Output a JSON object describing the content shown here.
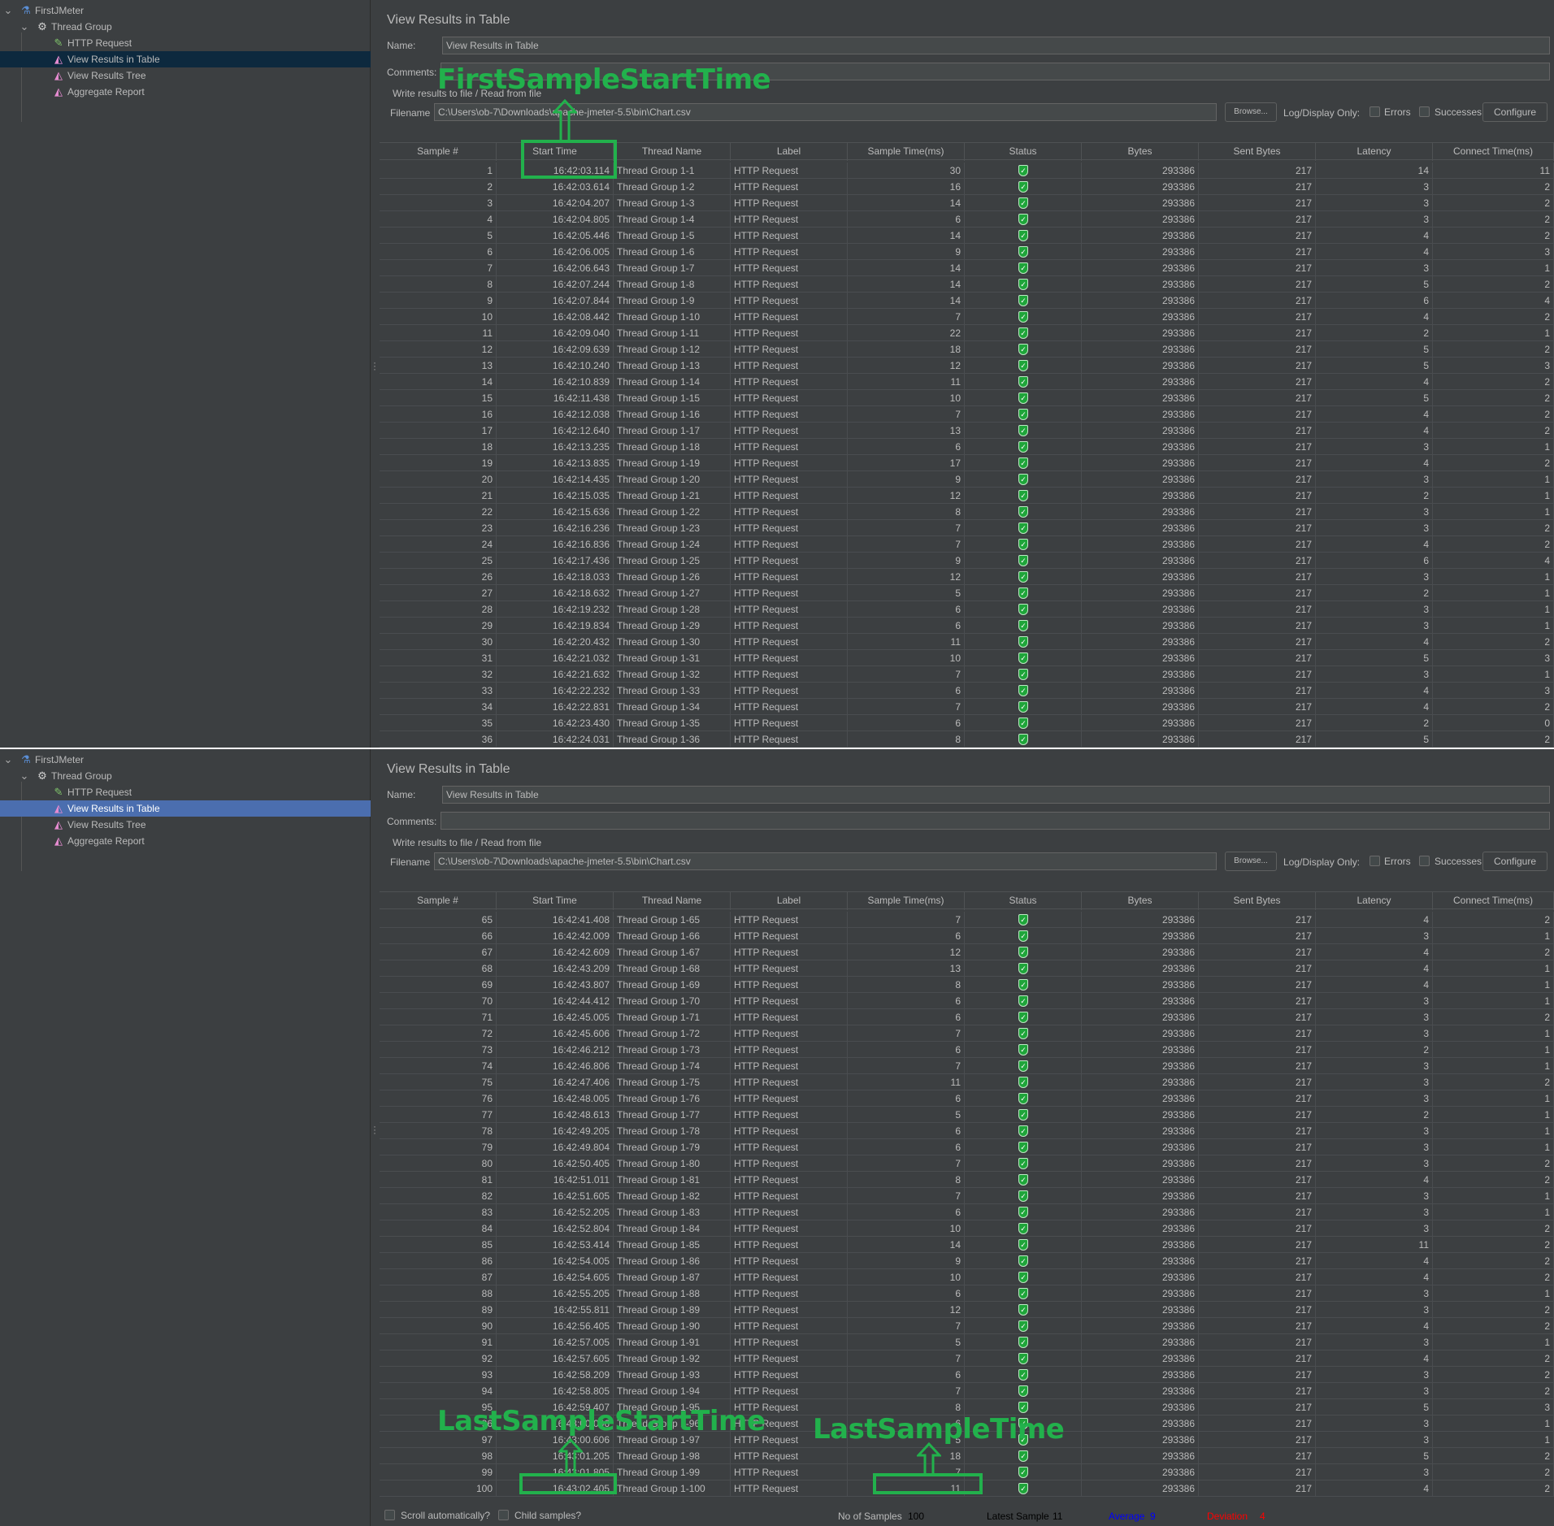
{
  "colors": {
    "background": "#3c3f41",
    "text": "#bbbbbb",
    "selection_dark": "#0d293e",
    "selection_blue": "#4b6eaf",
    "annotation": "#22b14c",
    "status_ok": "#1fa53a",
    "average": "#0000ff",
    "deviation": "#ff0000"
  },
  "tree": [
    {
      "label": "FirstJMeter",
      "icon": "test-plan-flask-icon",
      "level": 0,
      "expanded": true
    },
    {
      "label": "Thread Group",
      "icon": "thread-group-gear-icon",
      "level": 1,
      "expanded": true
    },
    {
      "label": "HTTP Request",
      "icon": "sampler-pipette-icon",
      "level": 2
    },
    {
      "label": "View Results in Table",
      "icon": "listener-graph-icon",
      "level": 2,
      "selected": true
    },
    {
      "label": "View Results Tree",
      "icon": "listener-graph-icon",
      "level": 2
    },
    {
      "label": "Aggregate Report",
      "icon": "listener-graph-icon",
      "level": 2
    }
  ],
  "form": {
    "title": "View Results in Table",
    "name_label": "Name:",
    "name_value": "View Results in Table",
    "comments_label": "Comments:",
    "comments_value": "",
    "write_results_label": "Write results to file / Read from file",
    "filename_label": "Filename",
    "filename_value": "C:\\Users\\ob-7\\Downloads\\apache-jmeter-5.5\\bin\\Chart.csv",
    "browse_label": "Browse...",
    "log_display_label": "Log/Display Only:",
    "errors_label": "Errors",
    "errors_checked": false,
    "successes_label": "Successes",
    "successes_checked": false,
    "configure_label": "Configure"
  },
  "columns": [
    "Sample #",
    "Start Time",
    "Thread Name",
    "Label",
    "Sample Time(ms)",
    "Status",
    "Bytes",
    "Sent Bytes",
    "Latency",
    "Connect Time(ms)"
  ],
  "panels": [
    {
      "selection": "dark",
      "rows": [
        [
          "1",
          "16:42:03.114",
          "Thread Group 1-1",
          "HTTP Request",
          "30",
          "success",
          "293386",
          "217",
          "14",
          "11"
        ],
        [
          "2",
          "16:42:03.614",
          "Thread Group 1-2",
          "HTTP Request",
          "16",
          "success",
          "293386",
          "217",
          "3",
          "2"
        ],
        [
          "3",
          "16:42:04.207",
          "Thread Group 1-3",
          "HTTP Request",
          "14",
          "success",
          "293386",
          "217",
          "3",
          "2"
        ],
        [
          "4",
          "16:42:04.805",
          "Thread Group 1-4",
          "HTTP Request",
          "6",
          "success",
          "293386",
          "217",
          "3",
          "2"
        ],
        [
          "5",
          "16:42:05.446",
          "Thread Group 1-5",
          "HTTP Request",
          "14",
          "success",
          "293386",
          "217",
          "4",
          "2"
        ],
        [
          "6",
          "16:42:06.005",
          "Thread Group 1-6",
          "HTTP Request",
          "9",
          "success",
          "293386",
          "217",
          "4",
          "3"
        ],
        [
          "7",
          "16:42:06.643",
          "Thread Group 1-7",
          "HTTP Request",
          "14",
          "success",
          "293386",
          "217",
          "3",
          "1"
        ],
        [
          "8",
          "16:42:07.244",
          "Thread Group 1-8",
          "HTTP Request",
          "14",
          "success",
          "293386",
          "217",
          "5",
          "2"
        ],
        [
          "9",
          "16:42:07.844",
          "Thread Group 1-9",
          "HTTP Request",
          "14",
          "success",
          "293386",
          "217",
          "6",
          "4"
        ],
        [
          "10",
          "16:42:08.442",
          "Thread Group 1-10",
          "HTTP Request",
          "7",
          "success",
          "293386",
          "217",
          "4",
          "2"
        ],
        [
          "11",
          "16:42:09.040",
          "Thread Group 1-11",
          "HTTP Request",
          "22",
          "success",
          "293386",
          "217",
          "2",
          "1"
        ],
        [
          "12",
          "16:42:09.639",
          "Thread Group 1-12",
          "HTTP Request",
          "18",
          "success",
          "293386",
          "217",
          "5",
          "2"
        ],
        [
          "13",
          "16:42:10.240",
          "Thread Group 1-13",
          "HTTP Request",
          "12",
          "success",
          "293386",
          "217",
          "5",
          "3"
        ],
        [
          "14",
          "16:42:10.839",
          "Thread Group 1-14",
          "HTTP Request",
          "11",
          "success",
          "293386",
          "217",
          "4",
          "2"
        ],
        [
          "15",
          "16:42:11.438",
          "Thread Group 1-15",
          "HTTP Request",
          "10",
          "success",
          "293386",
          "217",
          "5",
          "2"
        ],
        [
          "16",
          "16:42:12.038",
          "Thread Group 1-16",
          "HTTP Request",
          "7",
          "success",
          "293386",
          "217",
          "4",
          "2"
        ],
        [
          "17",
          "16:42:12.640",
          "Thread Group 1-17",
          "HTTP Request",
          "13",
          "success",
          "293386",
          "217",
          "4",
          "2"
        ],
        [
          "18",
          "16:42:13.235",
          "Thread Group 1-18",
          "HTTP Request",
          "6",
          "success",
          "293386",
          "217",
          "3",
          "1"
        ],
        [
          "19",
          "16:42:13.835",
          "Thread Group 1-19",
          "HTTP Request",
          "17",
          "success",
          "293386",
          "217",
          "4",
          "2"
        ],
        [
          "20",
          "16:42:14.435",
          "Thread Group 1-20",
          "HTTP Request",
          "9",
          "success",
          "293386",
          "217",
          "3",
          "1"
        ],
        [
          "21",
          "16:42:15.035",
          "Thread Group 1-21",
          "HTTP Request",
          "12",
          "success",
          "293386",
          "217",
          "2",
          "1"
        ],
        [
          "22",
          "16:42:15.636",
          "Thread Group 1-22",
          "HTTP Request",
          "8",
          "success",
          "293386",
          "217",
          "3",
          "1"
        ],
        [
          "23",
          "16:42:16.236",
          "Thread Group 1-23",
          "HTTP Request",
          "7",
          "success",
          "293386",
          "217",
          "3",
          "2"
        ],
        [
          "24",
          "16:42:16.836",
          "Thread Group 1-24",
          "HTTP Request",
          "7",
          "success",
          "293386",
          "217",
          "4",
          "2"
        ],
        [
          "25",
          "16:42:17.436",
          "Thread Group 1-25",
          "HTTP Request",
          "9",
          "success",
          "293386",
          "217",
          "6",
          "4"
        ],
        [
          "26",
          "16:42:18.033",
          "Thread Group 1-26",
          "HTTP Request",
          "12",
          "success",
          "293386",
          "217",
          "3",
          "1"
        ],
        [
          "27",
          "16:42:18.632",
          "Thread Group 1-27",
          "HTTP Request",
          "5",
          "success",
          "293386",
          "217",
          "2",
          "1"
        ],
        [
          "28",
          "16:42:19.232",
          "Thread Group 1-28",
          "HTTP Request",
          "6",
          "success",
          "293386",
          "217",
          "3",
          "1"
        ],
        [
          "29",
          "16:42:19.834",
          "Thread Group 1-29",
          "HTTP Request",
          "6",
          "success",
          "293386",
          "217",
          "3",
          "1"
        ],
        [
          "30",
          "16:42:20.432",
          "Thread Group 1-30",
          "HTTP Request",
          "11",
          "success",
          "293386",
          "217",
          "4",
          "2"
        ],
        [
          "31",
          "16:42:21.032",
          "Thread Group 1-31",
          "HTTP Request",
          "10",
          "success",
          "293386",
          "217",
          "5",
          "3"
        ],
        [
          "32",
          "16:42:21.632",
          "Thread Group 1-32",
          "HTTP Request",
          "7",
          "success",
          "293386",
          "217",
          "3",
          "1"
        ],
        [
          "33",
          "16:42:22.232",
          "Thread Group 1-33",
          "HTTP Request",
          "6",
          "success",
          "293386",
          "217",
          "4",
          "3"
        ],
        [
          "34",
          "16:42:22.831",
          "Thread Group 1-34",
          "HTTP Request",
          "7",
          "success",
          "293386",
          "217",
          "4",
          "2"
        ],
        [
          "35",
          "16:42:23.430",
          "Thread Group 1-35",
          "HTTP Request",
          "6",
          "success",
          "293386",
          "217",
          "2",
          "0"
        ],
        [
          "36",
          "16:42:24.031",
          "Thread Group 1-36",
          "HTTP Request",
          "8",
          "success",
          "293386",
          "217",
          "5",
          "2"
        ]
      ]
    },
    {
      "selection": "blue",
      "rows": [
        [
          "65",
          "16:42:41.408",
          "Thread Group 1-65",
          "HTTP Request",
          "7",
          "success",
          "293386",
          "217",
          "4",
          "2"
        ],
        [
          "66",
          "16:42:42.009",
          "Thread Group 1-66",
          "HTTP Request",
          "6",
          "success",
          "293386",
          "217",
          "3",
          "1"
        ],
        [
          "67",
          "16:42:42.609",
          "Thread Group 1-67",
          "HTTP Request",
          "12",
          "success",
          "293386",
          "217",
          "4",
          "2"
        ],
        [
          "68",
          "16:42:43.209",
          "Thread Group 1-68",
          "HTTP Request",
          "13",
          "success",
          "293386",
          "217",
          "4",
          "1"
        ],
        [
          "69",
          "16:42:43.807",
          "Thread Group 1-69",
          "HTTP Request",
          "8",
          "success",
          "293386",
          "217",
          "4",
          "1"
        ],
        [
          "70",
          "16:42:44.412",
          "Thread Group 1-70",
          "HTTP Request",
          "6",
          "success",
          "293386",
          "217",
          "3",
          "1"
        ],
        [
          "71",
          "16:42:45.005",
          "Thread Group 1-71",
          "HTTP Request",
          "6",
          "success",
          "293386",
          "217",
          "3",
          "2"
        ],
        [
          "72",
          "16:42:45.606",
          "Thread Group 1-72",
          "HTTP Request",
          "7",
          "success",
          "293386",
          "217",
          "3",
          "1"
        ],
        [
          "73",
          "16:42:46.212",
          "Thread Group 1-73",
          "HTTP Request",
          "6",
          "success",
          "293386",
          "217",
          "2",
          "1"
        ],
        [
          "74",
          "16:42:46.806",
          "Thread Group 1-74",
          "HTTP Request",
          "7",
          "success",
          "293386",
          "217",
          "3",
          "1"
        ],
        [
          "75",
          "16:42:47.406",
          "Thread Group 1-75",
          "HTTP Request",
          "11",
          "success",
          "293386",
          "217",
          "3",
          "2"
        ],
        [
          "76",
          "16:42:48.005",
          "Thread Group 1-76",
          "HTTP Request",
          "6",
          "success",
          "293386",
          "217",
          "3",
          "1"
        ],
        [
          "77",
          "16:42:48.613",
          "Thread Group 1-77",
          "HTTP Request",
          "5",
          "success",
          "293386",
          "217",
          "2",
          "1"
        ],
        [
          "78",
          "16:42:49.205",
          "Thread Group 1-78",
          "HTTP Request",
          "6",
          "success",
          "293386",
          "217",
          "3",
          "1"
        ],
        [
          "79",
          "16:42:49.804",
          "Thread Group 1-79",
          "HTTP Request",
          "6",
          "success",
          "293386",
          "217",
          "3",
          "1"
        ],
        [
          "80",
          "16:42:50.405",
          "Thread Group 1-80",
          "HTTP Request",
          "7",
          "success",
          "293386",
          "217",
          "3",
          "2"
        ],
        [
          "81",
          "16:42:51.011",
          "Thread Group 1-81",
          "HTTP Request",
          "8",
          "success",
          "293386",
          "217",
          "4",
          "2"
        ],
        [
          "82",
          "16:42:51.605",
          "Thread Group 1-82",
          "HTTP Request",
          "7",
          "success",
          "293386",
          "217",
          "3",
          "1"
        ],
        [
          "83",
          "16:42:52.205",
          "Thread Group 1-83",
          "HTTP Request",
          "6",
          "success",
          "293386",
          "217",
          "3",
          "1"
        ],
        [
          "84",
          "16:42:52.804",
          "Thread Group 1-84",
          "HTTP Request",
          "10",
          "success",
          "293386",
          "217",
          "3",
          "2"
        ],
        [
          "85",
          "16:42:53.414",
          "Thread Group 1-85",
          "HTTP Request",
          "14",
          "success",
          "293386",
          "217",
          "11",
          "2"
        ],
        [
          "86",
          "16:42:54.005",
          "Thread Group 1-86",
          "HTTP Request",
          "9",
          "success",
          "293386",
          "217",
          "4",
          "2"
        ],
        [
          "87",
          "16:42:54.605",
          "Thread Group 1-87",
          "HTTP Request",
          "10",
          "success",
          "293386",
          "217",
          "4",
          "2"
        ],
        [
          "88",
          "16:42:55.205",
          "Thread Group 1-88",
          "HTTP Request",
          "6",
          "success",
          "293386",
          "217",
          "3",
          "1"
        ],
        [
          "89",
          "16:42:55.811",
          "Thread Group 1-89",
          "HTTP Request",
          "12",
          "success",
          "293386",
          "217",
          "3",
          "2"
        ],
        [
          "90",
          "16:42:56.405",
          "Thread Group 1-90",
          "HTTP Request",
          "7",
          "success",
          "293386",
          "217",
          "4",
          "2"
        ],
        [
          "91",
          "16:42:57.005",
          "Thread Group 1-91",
          "HTTP Request",
          "5",
          "success",
          "293386",
          "217",
          "3",
          "1"
        ],
        [
          "92",
          "16:42:57.605",
          "Thread Group 1-92",
          "HTTP Request",
          "7",
          "success",
          "293386",
          "217",
          "4",
          "2"
        ],
        [
          "93",
          "16:42:58.209",
          "Thread Group 1-93",
          "HTTP Request",
          "6",
          "success",
          "293386",
          "217",
          "3",
          "2"
        ],
        [
          "94",
          "16:42:58.805",
          "Thread Group 1-94",
          "HTTP Request",
          "7",
          "success",
          "293386",
          "217",
          "3",
          "2"
        ],
        [
          "95",
          "16:42:59.407",
          "Thread Group 1-95",
          "HTTP Request",
          "8",
          "success",
          "293386",
          "217",
          "5",
          "3"
        ],
        [
          "96",
          "16:43:00.006",
          "Thread Group 1-96",
          "HTTP Request",
          "6",
          "success",
          "293386",
          "217",
          "3",
          "1"
        ],
        [
          "97",
          "16:43:00.606",
          "Thread Group 1-97",
          "HTTP Request",
          "5",
          "success",
          "293386",
          "217",
          "3",
          "1"
        ],
        [
          "98",
          "16:43:01.205",
          "Thread Group 1-98",
          "HTTP Request",
          "18",
          "success",
          "293386",
          "217",
          "5",
          "2"
        ],
        [
          "99",
          "16:43:01.805",
          "Thread Group 1-99",
          "HTTP Request",
          "7",
          "success",
          "293386",
          "217",
          "3",
          "2"
        ],
        [
          "100",
          "16:43:02.405",
          "Thread Group 1-100",
          "HTTP Request",
          "11",
          "success",
          "293386",
          "217",
          "4",
          "2"
        ]
      ]
    }
  ],
  "status_bar": {
    "scroll_label": "Scroll automatically?",
    "scroll_checked": false,
    "child_label": "Child samples?",
    "child_checked": false,
    "samples_label": "No of Samples",
    "samples_value": "100",
    "latest_label": "Latest Sample",
    "latest_value": "11",
    "average_label": "Average",
    "average_value": "9",
    "deviation_label": "Deviation",
    "deviation_value": "4"
  },
  "annotations": {
    "first_start": "FirstSampleStartTime",
    "last_start": "LastSampleStartTime",
    "last_time": "LastSampleTime"
  }
}
